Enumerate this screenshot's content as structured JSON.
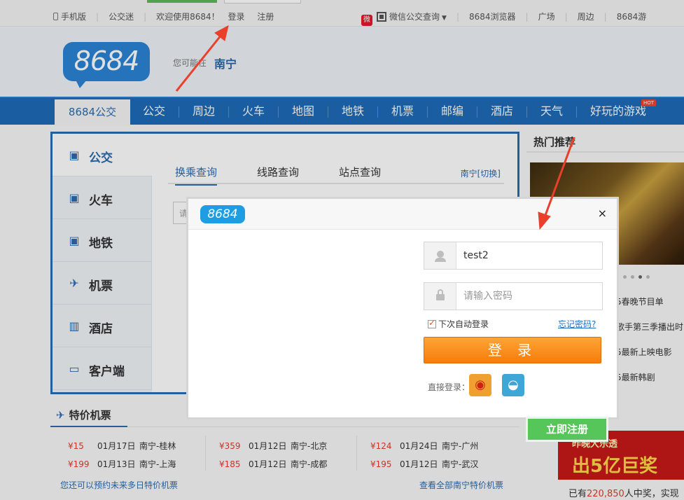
{
  "topbar": {
    "mobile": "手机版",
    "bus_fan": "公交迷",
    "welcome": "欢迎使用8684！",
    "login": "登录",
    "register": "注册",
    "wechat": "微信公交查询",
    "browser": "8684浏览器",
    "plaza": "广场",
    "nearby": "周边",
    "games": "8684游"
  },
  "header": {
    "logo": "8684",
    "city_hint": "您可能在",
    "city": "南宁"
  },
  "nav": {
    "active": "8684公交",
    "items": [
      "公交",
      "周边",
      "火车",
      "地图",
      "地铁",
      "机票",
      "邮编",
      "酒店",
      "天气",
      "好玩的游戏"
    ],
    "hot": "HOT"
  },
  "side_menu": [
    "公交",
    "火车",
    "地铁",
    "机票",
    "酒店",
    "客户端"
  ],
  "tabs": [
    "换乘查询",
    "线路查询",
    "站点查询"
  ],
  "city_switch": "南宁[切换]",
  "input_stub": "请",
  "flights": {
    "title": "特价机票",
    "columns": [
      [
        {
          "price": "¥15",
          "date": "01月17日",
          "route": "南宁-桂林"
        },
        {
          "price": "¥199",
          "date": "01月13日",
          "route": "南宁-上海"
        }
      ],
      [
        {
          "price": "¥359",
          "date": "01月12日",
          "route": "南宁-北京"
        },
        {
          "price": "¥185",
          "date": "01月12日",
          "route": "南宁-成都"
        }
      ],
      [
        {
          "price": "¥124",
          "date": "01月24日",
          "route": "南宁-广州"
        },
        {
          "price": "¥195",
          "date": "01月12日",
          "route": "南宁-武汉"
        }
      ]
    ],
    "footer_left": "您还可以预约未来多日特价机票",
    "footer_right": "查看全部南宁特价机票"
  },
  "hot": {
    "title": "热门推荐",
    "items": [
      "5春晚节目单",
      "歌手第三季播出时",
      "5最新上映电影",
      "5最新韩剧"
    ]
  },
  "lottery": {
    "line1": "昨晚大乐透",
    "line2": "出5亿巨奖"
  },
  "winners": {
    "prefix": "已有",
    "count": "220,850",
    "suffix": "人中奖，实现"
  },
  "modal": {
    "logo": "8684",
    "close": "×",
    "username_value": "test2",
    "password_placeholder": "请输入密码",
    "remember": "下次自动登录",
    "forgot": "忘记密码?",
    "login_button": "登 录",
    "direct_login": "直接登录：",
    "register_button": "立即注册"
  },
  "icons": [
    "phone-icon",
    "weibo-icon",
    "qr-code-icon",
    "bus-icon",
    "train-icon",
    "subway-icon",
    "plane-icon",
    "hotel-icon",
    "client-icon",
    "user-icon",
    "lock-icon",
    "qq-icon",
    "close-icon"
  ],
  "colors": {
    "nav_blue": "#1e6bb8",
    "login_orange": "#f47c0c",
    "register_green": "#56c55a",
    "price_red": "#e23d2d",
    "arrow_red": "#e8402a"
  }
}
